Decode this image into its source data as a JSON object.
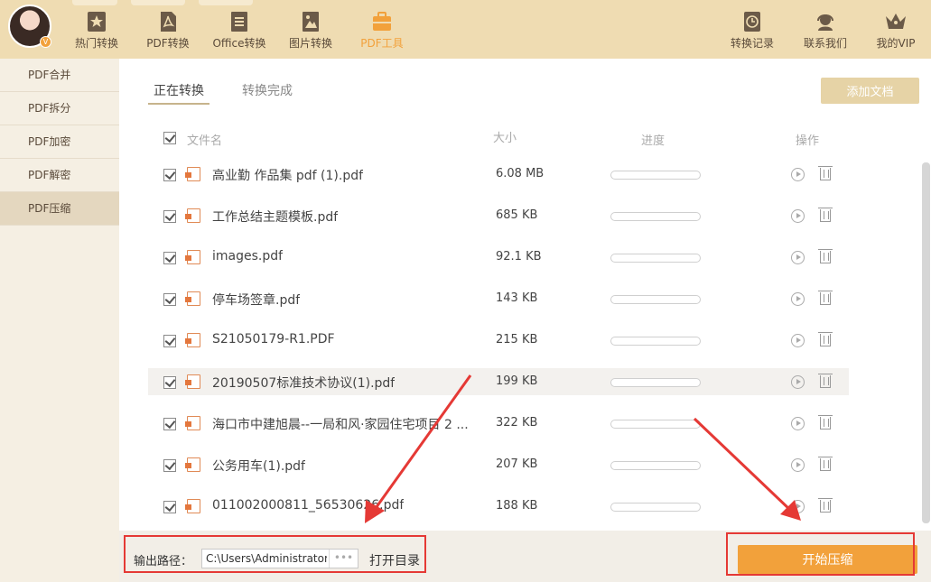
{
  "topbar": {
    "nav": [
      {
        "id": "hot",
        "label": "热门转换",
        "icon": "star-icon"
      },
      {
        "id": "pdf",
        "label": "PDF转换",
        "icon": "pdf-icon"
      },
      {
        "id": "office",
        "label": "Office转换",
        "icon": "document-icon"
      },
      {
        "id": "image",
        "label": "图片转换",
        "icon": "image-icon"
      },
      {
        "id": "tools",
        "label": "PDF工具",
        "icon": "toolbox-icon",
        "active": true
      }
    ],
    "right": [
      {
        "id": "history",
        "label": "转换记录",
        "icon": "clock-icon"
      },
      {
        "id": "contact",
        "label": "联系我们",
        "icon": "headset-icon"
      },
      {
        "id": "vip",
        "label": "我的VIP",
        "icon": "crown-icon"
      }
    ],
    "avatar_badge": "V"
  },
  "sidebar": {
    "items": [
      {
        "label": "PDF合并"
      },
      {
        "label": "PDF拆分"
      },
      {
        "label": "PDF加密"
      },
      {
        "label": "PDF解密"
      },
      {
        "label": "PDF压缩",
        "active": true
      }
    ]
  },
  "tabs": {
    "converting": "正在转换",
    "done": "转换完成"
  },
  "add_button": "添加文档",
  "table": {
    "headers": {
      "name": "文件名",
      "size": "大小",
      "progress": "进度",
      "action": "操作"
    },
    "rows": [
      {
        "name": "高业勤 作品集 pdf (1).pdf",
        "size": "6.08 MB",
        "progress": 0
      },
      {
        "name": "工作总结主题模板.pdf",
        "size": "685 KB",
        "progress": 0
      },
      {
        "name": "images.pdf",
        "size": "92.1 KB",
        "progress": 0
      },
      {
        "name": "停车场签章.pdf",
        "size": "143 KB",
        "progress": 0
      },
      {
        "name": "S21050179-R1.PDF",
        "size": "215 KB",
        "progress": 0
      },
      {
        "name": "20190507标准技术协议(1).pdf",
        "size": "199 KB",
        "progress": 0,
        "highlight": true
      },
      {
        "name": "海口市中建旭晨--一局和风·家园住宅项目 2 ...",
        "size": "322 KB",
        "progress": 0
      },
      {
        "name": "公务用车(1).pdf",
        "size": "207 KB",
        "progress": 0
      },
      {
        "name": "011002000811_56530626.pdf",
        "size": "188 KB",
        "progress": 0
      }
    ]
  },
  "bottom": {
    "output_label": "输出路径：",
    "path_value": "C:\\Users\\Administrator\\Desktop",
    "dots": "•••",
    "open_dir": "打开目录",
    "start_button": "开始压缩"
  },
  "colors": {
    "accent": "#f2a13b",
    "toolbar": "#efdcb2",
    "annotation": "#e53935"
  }
}
